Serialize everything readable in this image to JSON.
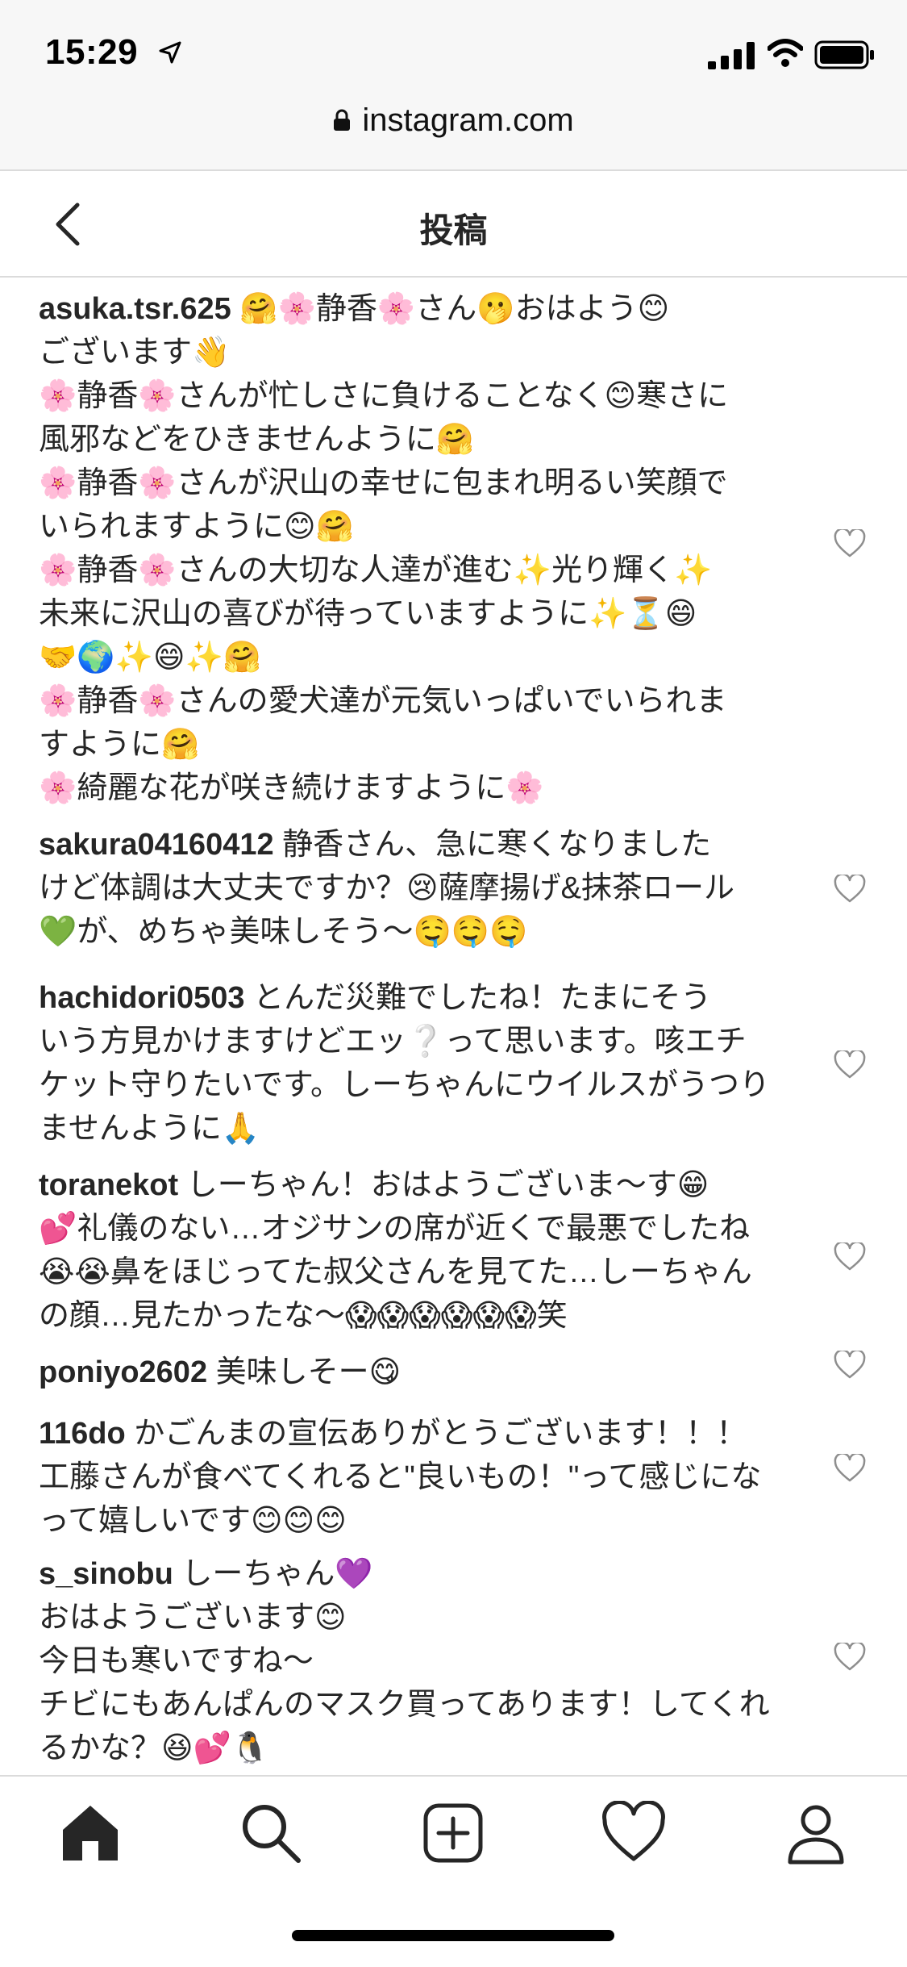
{
  "status_bar": {
    "time": "15:29"
  },
  "browser": {
    "url": "instagram.com"
  },
  "header": {
    "title": "投稿"
  },
  "comments": [
    {
      "username": "asuka.tsr.625",
      "text": " 🤗🌸静香🌸さん🫢おはよう😊\nございます👋\n🌸静香🌸さんが忙しさに負けることなく😊寒さに\n風邪などをひきませんように🤗\n🌸静香🌸さんが沢山の幸せに包まれ明るい笑顔で\nいられますように😊🤗\n🌸静香🌸さんの大切な人達が進む✨光り輝く✨\n未来に沢山の喜びが待っていますように✨⏳😄\n🤝🌍✨😄✨🤗\n🌸静香🌸さんの愛犬達が元気いっぱいでいられま\nすように🤗\n🌸綺麗な花が咲き続けますように🌸"
    },
    {
      "username": "sakura04160412",
      "text": " 静香さん、急に寒くなりました\nけど体調は大丈夫ですか？😢薩摩揚げ&抹茶ロール\n💚が、めちゃ美味しそう～🤤🤤🤤"
    },
    {
      "username": "hachidori0503",
      "text": " とんだ災難でしたね！たまにそう\nいう方見かけますけどエッ❔って思います。咳エチ\nケット守りたいです。しーちゃんにウイルスがうつり\nませんように🙏"
    },
    {
      "username": "toranekot",
      "text": " しーちゃん！おはようございま～す😁\n💕礼儀のない…オジサンの席が近くで最悪でしたね\n😭😭鼻をほじってた叔父さんを見てた…しーちゃん\nの顔…見たかったな～😱😱😱😱😱😱笑"
    },
    {
      "username": "poniyo2602",
      "text": " 美味しそー😋"
    },
    {
      "username": "116do",
      "text": " かごんまの宣伝ありがとうございます！！！\n工藤さんが食べてくれると\"良いもの！\"って感じにな\nって嬉しいです😊😊😊"
    },
    {
      "username": "s_sinobu",
      "text": " しーちゃん💜\nおはようございます😊\n今日も寒いですね～\nチビにもあんぱんのマスク買ってあります！してくれ\nるかな？😆💕🐧"
    }
  ],
  "tabbar": {
    "items": [
      "home",
      "search",
      "new-post",
      "activity",
      "profile"
    ]
  }
}
